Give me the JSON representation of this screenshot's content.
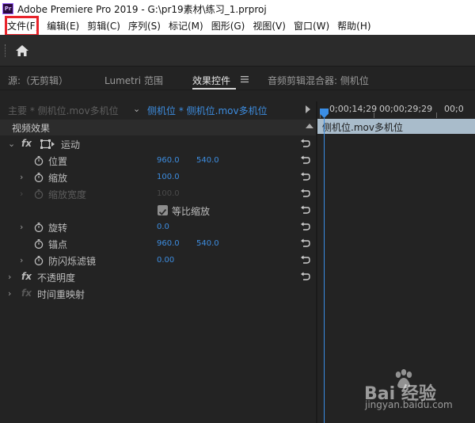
{
  "title_bar": {
    "app_icon": "Pr",
    "title": "Adobe Premiere Pro 2019 - G:\\pr19素材\\练习_1.prproj"
  },
  "menu": {
    "items": [
      "文件(F)",
      "编辑(E)",
      "剪辑(C)",
      "序列(S)",
      "标记(M)",
      "图形(G)",
      "视图(V)",
      "窗口(W)",
      "帮助(H)"
    ]
  },
  "toolbar": {
    "home_icon": "home-icon"
  },
  "panel_tabs": {
    "source": "源:（无剪辑）",
    "lumetri": "Lumetri 范围",
    "effect_controls": "效果控件",
    "audio_mixer": "音频剪辑混合器: 侧机位"
  },
  "effect_controls": {
    "master_clip": "主要 * 侧机位.mov多机位",
    "selected_clip": "侧机位 * 侧机位.mov多机位",
    "section_title": "视频效果",
    "motion": "运动",
    "position_label": "位置",
    "position_x": "960.0",
    "position_y": "540.0",
    "scale_label": "缩放",
    "scale_value": "100.0",
    "scale_width_label": "缩放宽度",
    "scale_width_value": "100.0",
    "uniform_scale_label": "等比缩放",
    "uniform_scale_checked": true,
    "rotation_label": "旋转",
    "rotation_value": "0.0",
    "anchor_label": "锚点",
    "anchor_x": "960.0",
    "anchor_y": "540.0",
    "flicker_label": "防闪烁滤镜",
    "flicker_value": "0.00",
    "opacity": "不透明度",
    "time_remap": "时间重映射",
    "fx_label": "fx"
  },
  "timeline": {
    "tc1": "0;00;14;29",
    "tc2": "00;00;29;29",
    "tc3": "00;0",
    "clip_name": "侧机位.mov多机位",
    "playhead_color": "#3a8ee6"
  },
  "watermark": {
    "brand": "Bai 经验",
    "url": "jingyan.baidu.com"
  }
}
